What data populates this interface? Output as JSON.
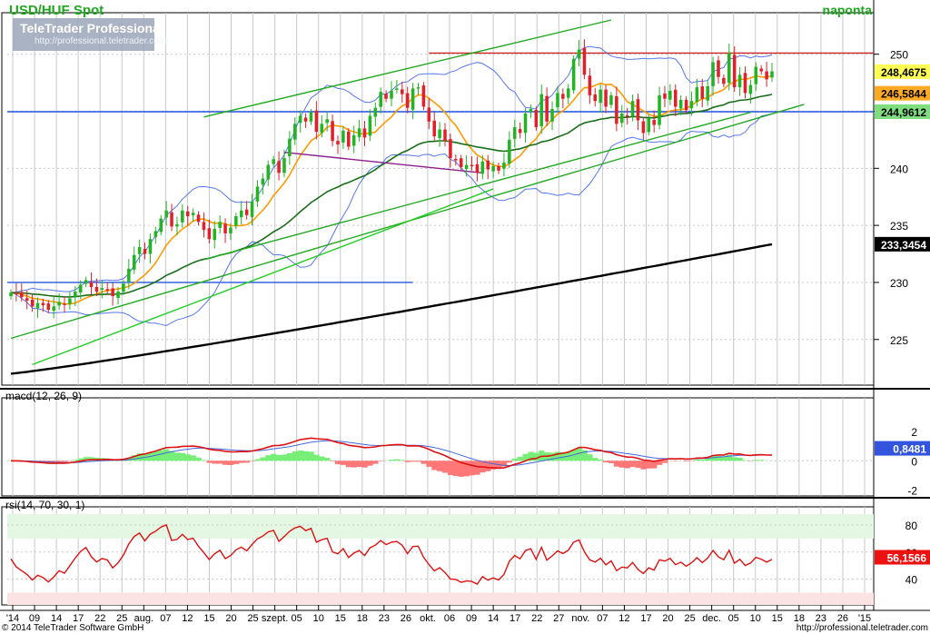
{
  "header": {
    "instrument": "USD/HUF Spot",
    "period": "naponta",
    "brand_name": "TeleTrader Professional",
    "brand_url": "http://professional.teletrader.com/"
  },
  "footer": {
    "copyright": "© 2014 TeleTrader Software GmbH",
    "url": "http://professional.teletrader.com"
  },
  "colors": {
    "bull_candle": "#22b422",
    "bear_candle": "#e0202a",
    "bollinger": "#5577ee",
    "ma_fast": "#ff9a00",
    "ma_mid": "#1a6e1a",
    "ma_slow": "#000000",
    "trendline": "#22aa22",
    "resistance_line": "#cc2222",
    "support_line": "#2255dd",
    "macd_line": "#dd1111",
    "macd_signal": "#4466dd",
    "rsi_line": "#dd1111",
    "grid": "#c8c8c8"
  },
  "chart_data": [
    {
      "type": "candlestick",
      "title": "USD/HUF Spot",
      "period": "naponta",
      "ylim": [
        221,
        253
      ],
      "yticks": [
        225,
        230,
        235,
        240,
        245,
        250
      ],
      "x_labels": [
        "'14",
        "09",
        "14",
        "17",
        "22",
        "25",
        "aug.",
        "07",
        "12",
        "15",
        "20",
        "25",
        "szept.",
        "05",
        "10",
        "15",
        "18",
        "23",
        "26",
        "okt.",
        "06",
        "09",
        "14",
        "17",
        "22",
        "27",
        "nov.",
        "07",
        "12",
        "17",
        "20",
        "25",
        "dec.",
        "05",
        "10",
        "15",
        "18",
        "23",
        "26",
        "'15"
      ],
      "ohlc_closes": [
        229.1,
        229.0,
        228.7,
        228.4,
        227.9,
        228.2,
        228.0,
        227.6,
        227.9,
        228.3,
        228.1,
        228.6,
        229.2,
        229.8,
        230.2,
        229.6,
        229.2,
        229.5,
        229.4,
        228.8,
        229.2,
        229.9,
        231.2,
        232.4,
        233.1,
        232.5,
        233.8,
        234.5,
        235.6,
        236.3,
        234.9,
        235.1,
        236.3,
        235.8,
        236.1,
        235.3,
        234.6,
        233.8,
        234.7,
        235.3,
        234.3,
        234.8,
        235.8,
        236.3,
        235.9,
        237.1,
        238.4,
        239.1,
        240.3,
        240.8,
        239.6,
        240.9,
        242.6,
        243.9,
        244.6,
        244.1,
        244.9,
        243.2,
        243.9,
        244.3,
        242.4,
        242.1,
        243.3,
        241.9,
        242.9,
        243.5,
        242.7,
        244.6,
        245.3,
        246.7,
        246.1,
        246.8,
        247.0,
        246.5,
        245.3,
        247.0,
        247.1,
        245.4,
        244.1,
        242.8,
        243.4,
        242.4,
        240.9,
        240.8,
        240.1,
        240.3,
        240.2,
        239.6,
        240.6,
        239.9,
        240.2,
        239.8,
        240.5,
        242.5,
        243.6,
        243.1,
        244.8,
        245.2,
        243.6,
        246.5,
        244.1,
        245.2,
        246.6,
        246.1,
        247.0,
        249.6,
        250.4,
        248.2,
        246.4,
        245.9,
        246.9,
        245.4,
        246.4,
        243.9,
        244.8,
        244.6,
        245.9,
        244.2,
        243.1,
        244.4,
        243.8,
        246.4,
        246.1,
        246.8,
        245.4,
        246.0,
        245.1,
        245.9,
        247.1,
        246.1,
        247.2,
        249.3,
        248.0,
        247.4,
        250.1,
        247.1,
        248.2,
        246.6,
        247.3,
        248.9,
        248.5,
        247.8,
        248.5
      ],
      "last_values": {
        "close": "248,4675",
        "ma_fast": "246,5844",
        "support": "244,9612",
        "ma_slow": "233,3454"
      },
      "horizontal_lines": [
        {
          "name": "resistance",
          "y": 250.1
        },
        {
          "name": "support",
          "y": 244.96
        },
        {
          "name": "support_old",
          "y": 230.0
        }
      ]
    },
    {
      "type": "line",
      "title": "macd(12, 26, 9)",
      "ylim": [
        -2.4,
        3.8
      ],
      "yticks": [
        -2,
        0,
        2
      ],
      "last_value": "0,8481"
    },
    {
      "type": "line",
      "title": "rsi(14, 70, 30, 1)",
      "ylim": [
        21,
        88
      ],
      "yticks": [
        40,
        60,
        80
      ],
      "bands": [
        30,
        70
      ],
      "last_value": "56,1566"
    }
  ]
}
